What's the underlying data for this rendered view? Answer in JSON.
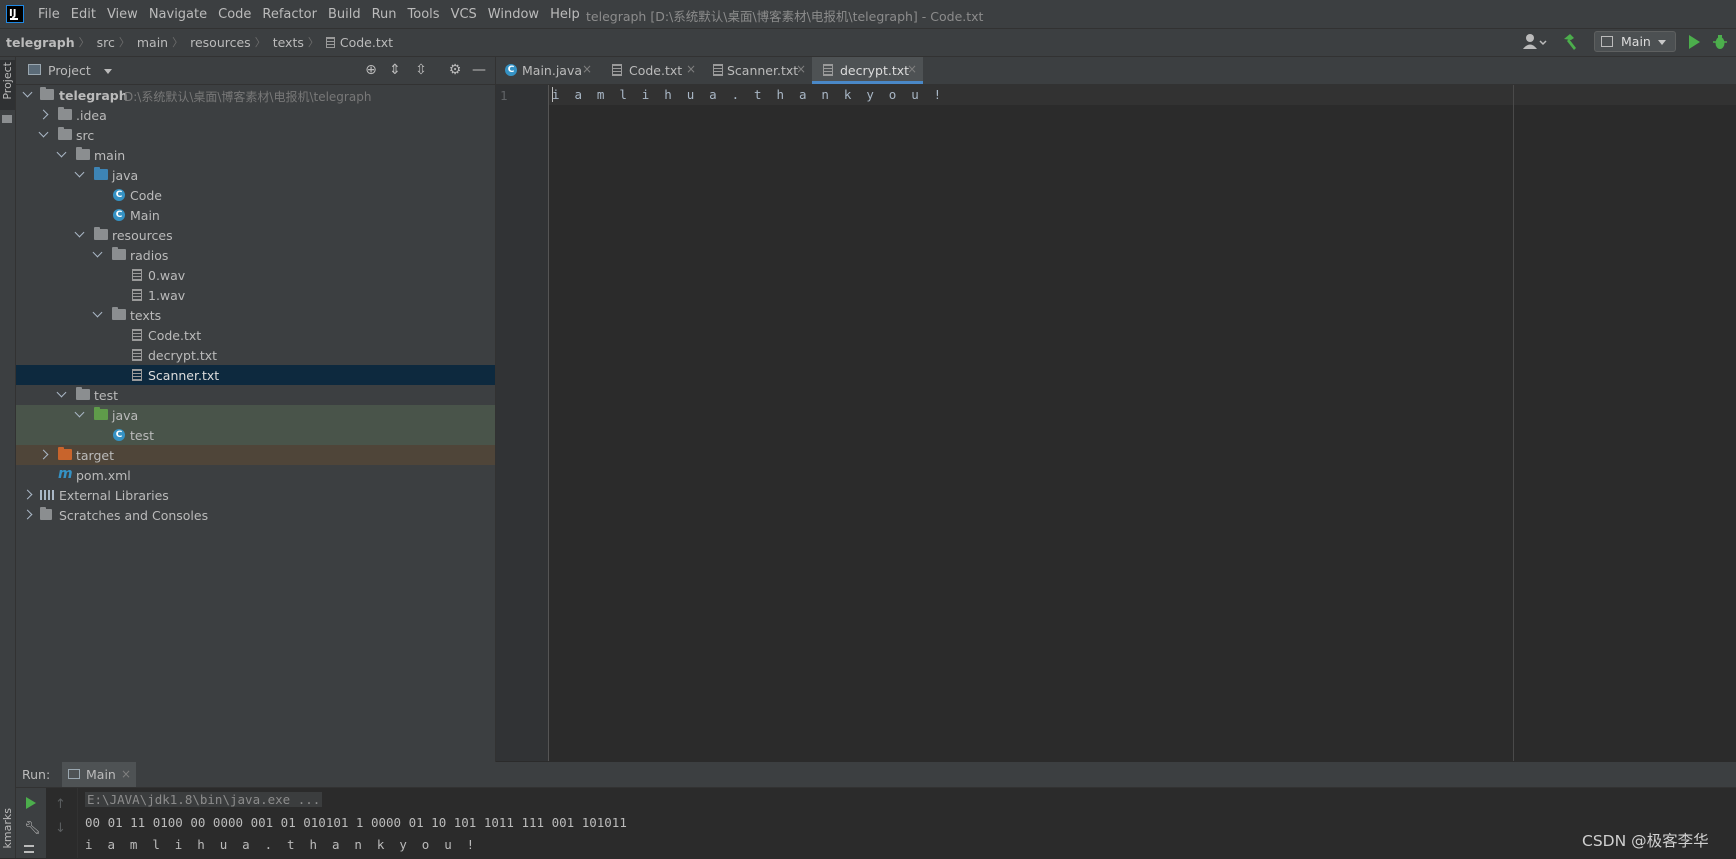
{
  "menu": {
    "items": [
      "File",
      "Edit",
      "View",
      "Navigate",
      "Code",
      "Refactor",
      "Build",
      "Run",
      "Tools",
      "VCS",
      "Window",
      "Help"
    ],
    "window_title": "telegraph [D:\\系统默认\\桌面\\博客素材\\电报机\\telegraph] - Code.txt"
  },
  "breadcrumb": [
    "telegraph",
    "src",
    "main",
    "resources",
    "texts",
    "Code.txt"
  ],
  "run_config": {
    "label": "Main"
  },
  "left_stripe": {
    "project": "Project",
    "bookmarks": "kmarks"
  },
  "project_panel": {
    "title": "Project",
    "tree": {
      "root_name": "telegraph",
      "root_path": "D:\\系统默认\\桌面\\博客素材\\电报机\\telegraph",
      "idea": ".idea",
      "src": "src",
      "main": "main",
      "java": "java",
      "code": "Code",
      "main_class": "Main",
      "resources": "resources",
      "radios": "radios",
      "wav0": "0.wav",
      "wav1": "1.wav",
      "texts": "texts",
      "code_txt": "Code.txt",
      "decrypt_txt": "decrypt.txt",
      "scanner_txt": "Scanner.txt",
      "test": "test",
      "test_java": "java",
      "test_class": "test",
      "target": "target",
      "pom": "pom.xml",
      "ext_libs": "External Libraries",
      "scratches": "Scratches and Consoles"
    }
  },
  "editor": {
    "tabs": [
      "Main.java",
      "Code.txt",
      "Scanner.txt",
      "decrypt.txt"
    ],
    "active_tab": "decrypt.txt",
    "line_number": "1",
    "content": "i a m l i h u a . t h a n k y o u !"
  },
  "run_panel": {
    "label": "Run:",
    "tab": "Main",
    "console": {
      "cmd": "E:\\JAVA\\jdk1.8\\bin\\java.exe ...",
      "out1": "00 01 11 0100 00 0000 001 01 010101 1 0000 01 10 101 1011 111 001 101011",
      "out2": "i a m l i h u a . t h a n k y o u !"
    }
  },
  "watermark": "CSDN @极客李华"
}
